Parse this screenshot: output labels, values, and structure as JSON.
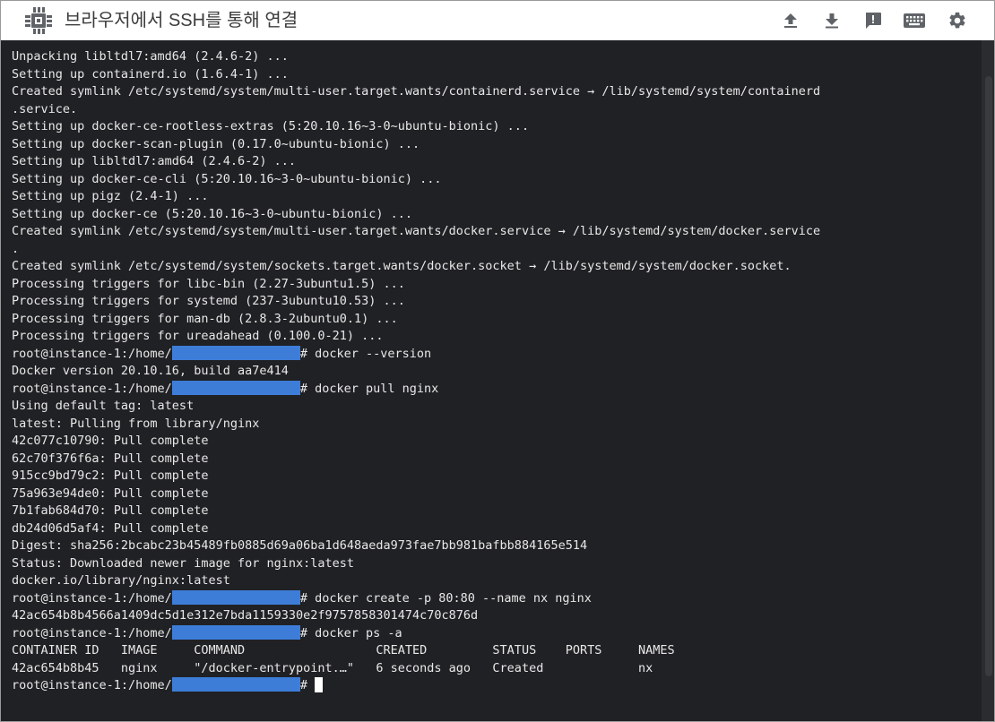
{
  "header": {
    "title": "브라우저에서 SSH를 통해 연결",
    "app_icon": "chip-icon",
    "actions": [
      {
        "name": "upload-button",
        "icon": "upload-icon"
      },
      {
        "name": "download-button",
        "icon": "download-icon"
      },
      {
        "name": "feedback-button",
        "icon": "feedback-icon"
      },
      {
        "name": "keyboard-button",
        "icon": "keyboard-icon"
      },
      {
        "name": "settings-button",
        "icon": "gear-icon"
      }
    ]
  },
  "colors": {
    "terminal_bg": "#202124",
    "terminal_text": "#e8e8e8",
    "redaction": "#3d7dd8",
    "titlebar_icon": "#5f6368"
  },
  "terminal": {
    "prompt_prefix": "root@instance-1:/home/",
    "prompt_suffix": "#",
    "lines": [
      "Unpacking libltdl7:amd64 (2.4.6-2) ...",
      "Setting up containerd.io (1.6.4-1) ...",
      "Created symlink /etc/systemd/system/multi-user.target.wants/containerd.service → /lib/systemd/system/containerd",
      ".service.",
      "Setting up docker-ce-rootless-extras (5:20.10.16~3-0~ubuntu-bionic) ...",
      "Setting up docker-scan-plugin (0.17.0~ubuntu-bionic) ...",
      "Setting up libltdl7:amd64 (2.4.6-2) ...",
      "Setting up docker-ce-cli (5:20.10.16~3-0~ubuntu-bionic) ...",
      "Setting up pigz (2.4-1) ...",
      "Setting up docker-ce (5:20.10.16~3-0~ubuntu-bionic) ...",
      "Created symlink /etc/systemd/system/multi-user.target.wants/docker.service → /lib/systemd/system/docker.service",
      ".",
      "Created symlink /etc/systemd/system/sockets.target.wants/docker.socket → /lib/systemd/system/docker.socket.",
      "Processing triggers for libc-bin (2.27-3ubuntu1.5) ...",
      "Processing triggers for systemd (237-3ubuntu10.53) ...",
      "Processing triggers for man-db (2.8.3-2ubuntu0.1) ...",
      "Processing triggers for ureadahead (0.100.0-21) ..."
    ],
    "cmd_version": " docker --version",
    "out_version": "Docker version 20.10.16, build aa7e414",
    "cmd_pull": " docker pull nginx",
    "pull_lines": [
      "Using default tag: latest",
      "latest: Pulling from library/nginx",
      "42c077c10790: Pull complete",
      "62c70f376f6a: Pull complete",
      "915cc9bd79c2: Pull complete",
      "75a963e94de0: Pull complete",
      "7b1fab684d70: Pull complete",
      "db24d06d5af4: Pull complete",
      "Digest: sha256:2bcabc23b45489fb0885d69a06ba1d648aeda973fae7bb981bafbb884165e514",
      "Status: Downloaded newer image for nginx:latest",
      "docker.io/library/nginx:latest"
    ],
    "cmd_create": " docker create -p 80:80 --name nx nginx",
    "out_create": "42ac654b8b4566a1409dc5d1e312e7bda1159330e2f9757858301474c70c876d",
    "cmd_ps": " docker ps -a",
    "ps_header": "CONTAINER ID   IMAGE     COMMAND                  CREATED         STATUS    PORTS     NAMES",
    "ps_row": "42ac654b8b45   nginx     \"/docker-entrypoint.…\"   6 seconds ago   Created             nx"
  }
}
